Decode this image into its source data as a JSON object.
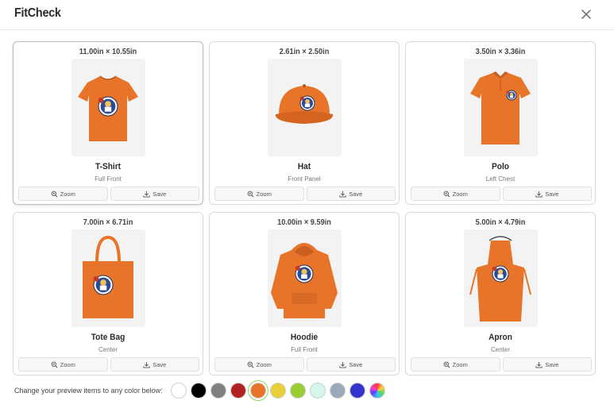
{
  "app": {
    "title": "FitCheck"
  },
  "products": [
    {
      "dims": "11.00in × 10.55in",
      "name": "T-Shirt",
      "placement": "Full Front",
      "shape": "tshirt",
      "selected": true
    },
    {
      "dims": "2.61in × 2.50in",
      "name": "Hat",
      "placement": "Front Panel",
      "shape": "hat",
      "selected": false
    },
    {
      "dims": "3.50in × 3.36in",
      "name": "Polo",
      "placement": "Left Chest",
      "shape": "polo",
      "selected": false
    },
    {
      "dims": "7.00in × 6.71in",
      "name": "Tote Bag",
      "placement": "Center",
      "shape": "tote",
      "selected": false
    },
    {
      "dims": "10.00in × 9.59in",
      "name": "Hoodie",
      "placement": "Full Front",
      "shape": "hoodie",
      "selected": false
    },
    {
      "dims": "5.00in × 4.79in",
      "name": "Apron",
      "placement": "Center",
      "shape": "apron",
      "selected": false
    }
  ],
  "actions": {
    "zoom_label": "Zoom",
    "save_label": "Save"
  },
  "colors": {
    "label": "Change your preview items to any color below:",
    "item_color": "#e8742a",
    "swatches": [
      {
        "name": "white",
        "color": "#ffffff"
      },
      {
        "name": "black",
        "color": "#000000"
      },
      {
        "name": "gray",
        "color": "#808080"
      },
      {
        "name": "red",
        "color": "#b22222"
      },
      {
        "name": "orange",
        "color": "#e8742a",
        "active": true
      },
      {
        "name": "yellow",
        "color": "#e8cf3a"
      },
      {
        "name": "lime",
        "color": "#9acd32"
      },
      {
        "name": "mint",
        "color": "#d6f5ec"
      },
      {
        "name": "slate",
        "color": "#9aaabb"
      },
      {
        "name": "blue",
        "color": "#3535cc"
      },
      {
        "name": "rainbow",
        "color": "conic-gradient"
      }
    ]
  }
}
